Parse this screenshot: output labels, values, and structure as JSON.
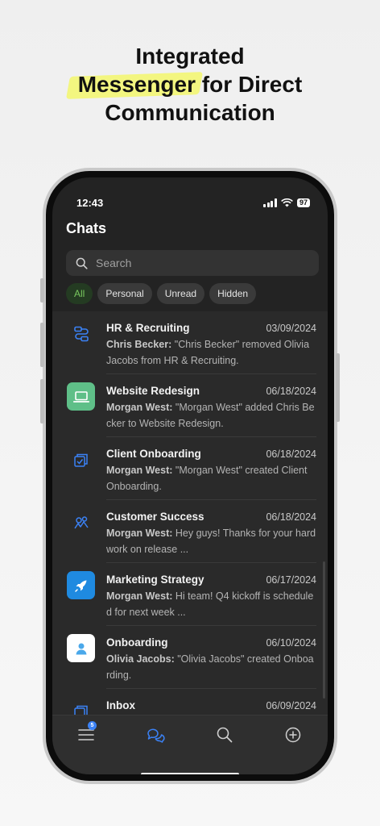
{
  "headline": {
    "highlight": "Messenger",
    "line1": "Integrated",
    "line2_rest": "for Direct",
    "line3": "Communication"
  },
  "status_bar": {
    "time": "12:43",
    "battery": "97"
  },
  "screen_title": "Chats",
  "search": {
    "placeholder": "Search"
  },
  "filters": [
    "All",
    "Personal",
    "Unread",
    "Hidden"
  ],
  "active_filter": "All",
  "chats": [
    {
      "name": "HR & Recruiting",
      "date": "03/09/2024",
      "sender": "Chris Becker:",
      "message": "\"Chris Becker\" removed Olivia Jacobs from HR & Recruiting.",
      "icon": "workflow-icon",
      "sender_bold": false
    },
    {
      "name": "Website Redesign",
      "date": "06/18/2024",
      "sender": "Morgan West:",
      "message": "\"Morgan West\" added Chris Becker to Website Redesign.",
      "icon": "laptop-icon",
      "sender_bold": false
    },
    {
      "name": "Client Onboarding",
      "date": "06/18/2024",
      "sender": "Morgan West:",
      "message": "\"Morgan West\" created Client Onboarding.",
      "icon": "stacked-cards-icon",
      "sender_bold": false
    },
    {
      "name": "Customer Success",
      "date": "06/18/2024",
      "sender": "Morgan West:",
      "message": "Hey guys! Thanks for your hard work on release ...",
      "icon": "team-icon",
      "sender_bold": true
    },
    {
      "name": "Marketing Strategy",
      "date": "06/17/2024",
      "sender": "Morgan West:",
      "message": "Hi team! Q4 kickoff is scheduled for next week ...",
      "icon": "rocket-icon",
      "sender_bold": true
    },
    {
      "name": "Onboarding",
      "date": "06/10/2024",
      "sender": "Olivia Jacobs:",
      "message": "\"Olivia Jacobs\" created Onboarding.",
      "icon": "person-icon",
      "sender_bold": true
    },
    {
      "name": "Inbox",
      "date": "06/09/2024",
      "sender": "",
      "message": "",
      "icon": "stacked-cards-icon",
      "sender_bold": false
    }
  ],
  "tab_bar": {
    "menu_badge": "5",
    "tabs": [
      "menu-icon",
      "chats-icon",
      "search-icon",
      "add-icon"
    ]
  },
  "colors": {
    "accent": "#3b82f6",
    "active_chip_text": "#79c85f",
    "highlight": "#f3f680"
  }
}
